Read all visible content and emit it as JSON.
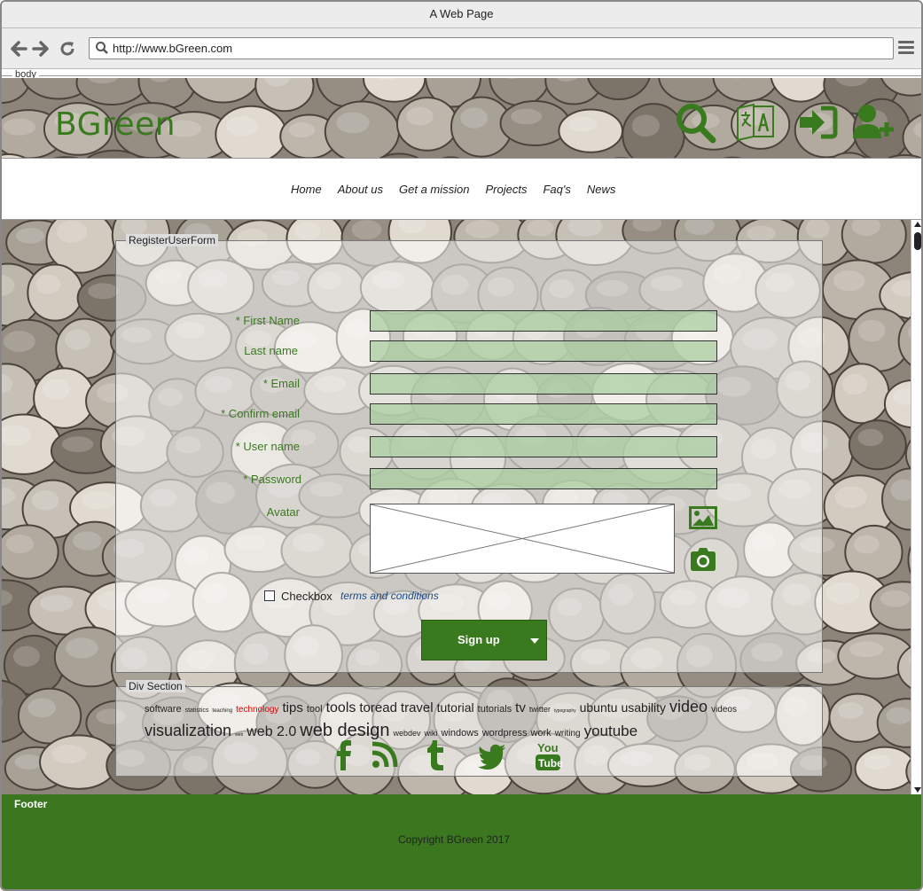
{
  "browser": {
    "window_title": "A Web Page",
    "url": "http://www.bGreen.com",
    "body_label": "body"
  },
  "header": {
    "logo": "BGreen",
    "icons": [
      "search-icon",
      "language-icon",
      "login-icon",
      "add-user-icon"
    ]
  },
  "nav": {
    "items": [
      "Home",
      "About us",
      "Get a mission",
      "Projects",
      "Faq's",
      "News"
    ]
  },
  "form": {
    "legend": "RegisterUserForm",
    "fields": [
      {
        "label": "* First Name",
        "value": ""
      },
      {
        "label": "Last name",
        "value": ""
      },
      {
        "label": "* Email",
        "value": ""
      },
      {
        "label": "* Confirm email",
        "value": ""
      },
      {
        "label": "* User name",
        "value": ""
      },
      {
        "label": "* Password",
        "value": ""
      }
    ],
    "avatar_label": "Avatar",
    "checkbox_label": "Checkbox",
    "terms_link": "terms and conditions",
    "signup_label": "Sign up"
  },
  "div_section": {
    "legend": "Div Section",
    "tags": [
      {
        "text": "software",
        "size": 11
      },
      {
        "text": "statistics",
        "size": 7
      },
      {
        "text": "teaching",
        "size": 6
      },
      {
        "text": "technology",
        "size": 10,
        "color": "#e00000"
      },
      {
        "text": "tips",
        "size": 15
      },
      {
        "text": "tool",
        "size": 11
      },
      {
        "text": "tools",
        "size": 16
      },
      {
        "text": "toread",
        "size": 15
      },
      {
        "text": "travel",
        "size": 15
      },
      {
        "text": "tutorial",
        "size": 14
      },
      {
        "text": "tutorials",
        "size": 11
      },
      {
        "text": "tv",
        "size": 15
      },
      {
        "text": "twitter",
        "size": 9
      },
      {
        "text": "typography",
        "size": 5
      },
      {
        "text": "ubuntu",
        "size": 14
      },
      {
        "text": "usability",
        "size": 14
      },
      {
        "text": "video",
        "size": 18
      },
      {
        "text": "videos",
        "size": 10
      },
      {
        "text": "visualization",
        "size": 18
      },
      {
        "text": "web",
        "size": 5
      },
      {
        "text": "web 2.0",
        "size": 16
      },
      {
        "text": "web design",
        "size": 20
      },
      {
        "text": "webdev",
        "size": 9
      },
      {
        "text": "wiki",
        "size": 9
      },
      {
        "text": "windows",
        "size": 11
      },
      {
        "text": "wordpress",
        "size": 11
      },
      {
        "text": "work",
        "size": 11
      },
      {
        "text": "writing",
        "size": 10
      },
      {
        "text": "youtube",
        "size": 17
      }
    ],
    "social": [
      "facebook-icon",
      "rss-icon",
      "tumblr-icon",
      "twitter-icon",
      "youtube-icon"
    ]
  },
  "footer": {
    "label": "Footer",
    "copyright": "Copyright BGreen 2017"
  },
  "colors": {
    "brand_green": "#3a7a1f",
    "footer_green": "#3a771f",
    "input_fill": "#aacda0",
    "link_blue": "#1a4a8a",
    "tag_highlight": "#e00000"
  }
}
